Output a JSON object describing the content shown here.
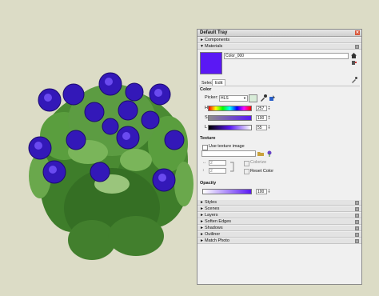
{
  "tray": {
    "title": "Default Tray",
    "sections_top": [
      {
        "label": "Components",
        "arrow": "►"
      },
      {
        "label": "Materials",
        "arrow": "▼"
      }
    ],
    "material": {
      "name": "Color_000",
      "swatch_color": "#5a18f4"
    },
    "tabs": {
      "select": "Select",
      "edit": "Edit"
    },
    "color": {
      "heading": "Color",
      "picker_label": "Picker:",
      "picker_value": "HLS",
      "rows": [
        {
          "label": "H",
          "value": "257"
        },
        {
          "label": "S",
          "value": "100"
        },
        {
          "label": "L",
          "value": "55"
        }
      ]
    },
    "texture": {
      "heading": "Texture",
      "use_texture_label": "Use texture image",
      "width_value": "2",
      "height_value": "2",
      "colorize_label": "Colorize",
      "reset_label": "Reset Color"
    },
    "opacity": {
      "heading": "Opacity",
      "value": "100"
    },
    "sections_bottom": [
      {
        "label": "Styles"
      },
      {
        "label": "Scenes"
      },
      {
        "label": "Layers"
      },
      {
        "label": "Soften Edges"
      },
      {
        "label": "Shadows"
      },
      {
        "label": "Outliner"
      },
      {
        "label": "Match Photo"
      }
    ]
  },
  "colors": {
    "background": "#dcdcc6",
    "material_purple": "#5a18f4",
    "leaf_green": "#3f8f2a"
  },
  "icons": [
    "close-icon",
    "arrow-right-icon",
    "arrow-down-icon",
    "house-icon",
    "paint-icon",
    "eyedropper-icon",
    "folder-icon",
    "plant-icon"
  ]
}
